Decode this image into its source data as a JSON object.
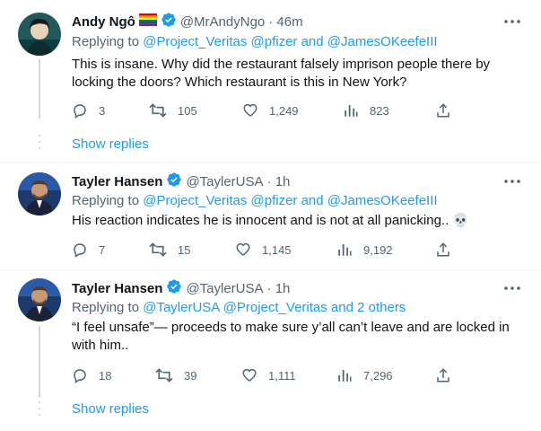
{
  "tweets": [
    {
      "author": "Andy Ngô",
      "handle": "@MrAndyNgo",
      "time": "· 46m",
      "replying_label": "Replying to ",
      "replying_to": "@Project_Veritas @pfizer and @JamesOKeefeIII",
      "text": "This is insane. Why did the restaurant falsely imprison people there by locking the doors? Which restaurant is this in New York?",
      "replies": "3",
      "retweets": "105",
      "likes": "1,249",
      "views": "823"
    },
    {
      "author": "Tayler Hansen",
      "handle": "@TaylerUSA",
      "time": "· 1h",
      "replying_label": "Replying to ",
      "replying_to": "@Project_Veritas @pfizer and @JamesOKeefeIII",
      "text": "His reaction indicates he is innocent and is not at all panicking.. 💀",
      "replies": "7",
      "retweets": "15",
      "likes": "1,145",
      "views": "9,192"
    },
    {
      "author": "Tayler Hansen",
      "handle": "@TaylerUSA",
      "time": "· 1h",
      "replying_label": "Replying to ",
      "replying_to": "@TaylerUSA @Project_Veritas and 2 others",
      "text": "“I feel unsafe”— proceeds to make sure y’all can’t leave and are locked in with him..",
      "replies": "18",
      "retweets": "39",
      "likes": "1,111",
      "views": "7,296"
    }
  ],
  "show_replies_label": "Show replies",
  "colors": {
    "link": "#1d9bf0",
    "muted": "#536471",
    "verified": "#1d9bf0",
    "thread_line": "#cfd9de"
  },
  "icons": [
    "more-icon",
    "verified-icon",
    "rainbow-flag-icon",
    "reply-icon",
    "retweet-icon",
    "like-icon",
    "views-icon",
    "share-icon"
  ]
}
